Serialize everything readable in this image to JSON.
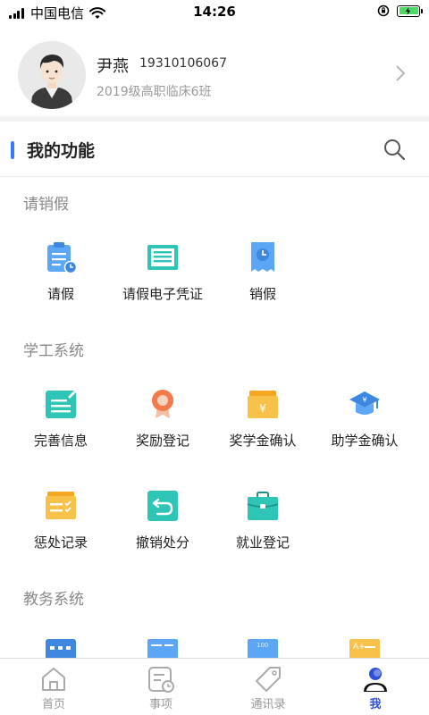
{
  "status_bar": {
    "carrier": "中国电信",
    "time": "14:26"
  },
  "profile": {
    "name": "尹燕",
    "phone": "19310106067",
    "class": "2019级高职临床6班"
  },
  "section": {
    "title": "我的功能"
  },
  "groups": [
    {
      "label": "请销假",
      "items": [
        {
          "label": "请假",
          "icon": "clipboard-clock-icon"
        },
        {
          "label": "请假电子凭证",
          "icon": "certificate-icon"
        },
        {
          "label": "销假",
          "icon": "receipt-clock-icon"
        }
      ]
    },
    {
      "label": "学工系统",
      "items": [
        {
          "label": "完善信息",
          "icon": "edit-card-icon"
        },
        {
          "label": "奖励登记",
          "icon": "medal-icon"
        },
        {
          "label": "奖学金确认",
          "icon": "yuan-folder-icon"
        },
        {
          "label": "助学金确认",
          "icon": "graduation-cap-icon"
        },
        {
          "label": "惩处记录",
          "icon": "checklist-icon"
        },
        {
          "label": "撤销处分",
          "icon": "undo-icon"
        },
        {
          "label": "就业登记",
          "icon": "briefcase-icon"
        }
      ]
    },
    {
      "label": "教务系统",
      "items": [
        {
          "label": "",
          "icon": "calendar-icon"
        },
        {
          "label": "",
          "icon": "card-icon"
        },
        {
          "label": "",
          "icon": "score-icon"
        },
        {
          "label": "",
          "icon": "grade-icon"
        }
      ]
    }
  ],
  "tabbar": {
    "items": [
      {
        "label": "首页",
        "icon": "home-icon"
      },
      {
        "label": "事项",
        "icon": "tasks-icon"
      },
      {
        "label": "通讯录",
        "icon": "tag-icon"
      },
      {
        "label": "我",
        "icon": "profile-icon",
        "active": true
      }
    ]
  },
  "colors": {
    "accent": "#3a7bf2",
    "active_tab": "#2e4fd6",
    "battery": "#4cd964"
  }
}
